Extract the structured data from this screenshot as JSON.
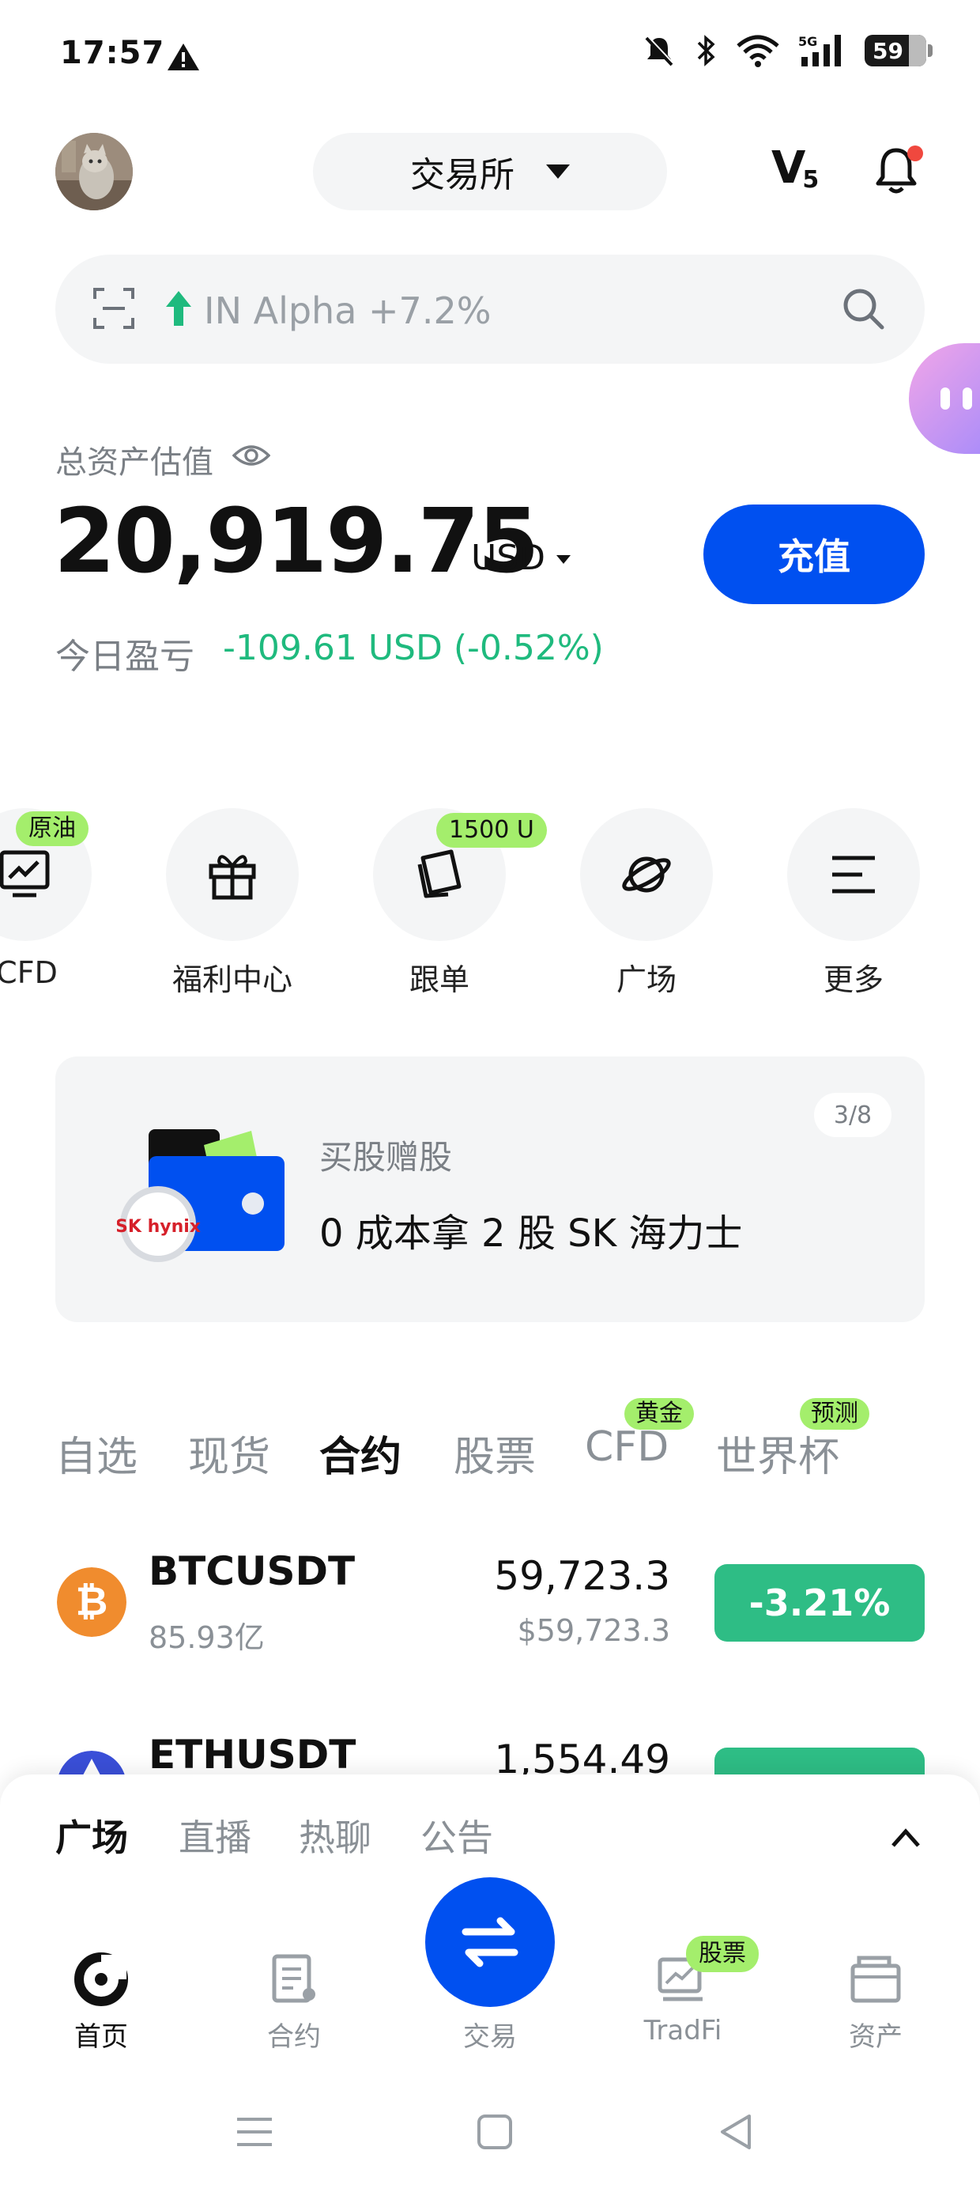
{
  "status_bar": {
    "time": "17:57",
    "battery": "59"
  },
  "header": {
    "exchange_label": "交易所",
    "vip_level": "V",
    "vip_sub": "5"
  },
  "search": {
    "trending_text": "IN Alpha +7.2%"
  },
  "assets": {
    "label": "总资产估值",
    "value": "20,919.75",
    "unit": "USD",
    "deposit_label": "充值",
    "pnl_label": "今日盈亏",
    "pnl_value": "-109.61 USD (-0.52%)"
  },
  "shortcuts": [
    {
      "label": "CFD",
      "tag": "原油",
      "icon": "chart-icon"
    },
    {
      "label": "福利中心",
      "tag": "",
      "icon": "gift-icon"
    },
    {
      "label": "跟单",
      "tag": "1500 U",
      "icon": "cards-icon"
    },
    {
      "label": "广场",
      "tag": "",
      "icon": "planet-icon"
    },
    {
      "label": "更多",
      "tag": "",
      "icon": "menu-icon"
    }
  ],
  "banner": {
    "subtitle": "买股赠股",
    "title": "0 成本拿 2 股 SK 海力士",
    "counter": "3/8",
    "logo_text": "SK hynix"
  },
  "market_tabs": [
    {
      "label": "自选",
      "tag": ""
    },
    {
      "label": "现货",
      "tag": ""
    },
    {
      "label": "合约",
      "tag": "",
      "active": true
    },
    {
      "label": "股票",
      "tag": ""
    },
    {
      "label": "CFD",
      "tag": "黄金"
    },
    {
      "label": "世界杯",
      "tag": "预测"
    }
  ],
  "market_rows": [
    {
      "symbol": "BTCUSDT",
      "volume": "85.93亿",
      "price": "59,723.3",
      "fiat": "$59,723.3",
      "change": "-3.21%",
      "icon": "bitcoin-icon"
    },
    {
      "symbol": "ETHUSDT",
      "volume": "",
      "price": "1,554.49",
      "fiat": "",
      "change": "",
      "icon": "ethereum-icon"
    }
  ],
  "sheet_tabs": [
    {
      "label": "广场",
      "active": true
    },
    {
      "label": "直播"
    },
    {
      "label": "热聊"
    },
    {
      "label": "公告"
    }
  ],
  "bottom_nav": [
    {
      "label": "首页",
      "active": true
    },
    {
      "label": "合约"
    },
    {
      "label": "交易"
    },
    {
      "label": "TradFi",
      "tag": "股票"
    },
    {
      "label": "资产"
    }
  ],
  "colors": {
    "brand": "#0050f0",
    "up_green": "#1fba7e",
    "badge_green": "#2ebd85",
    "tag_lime": "#a4ee6c",
    "alert_red": "#f0483e"
  }
}
